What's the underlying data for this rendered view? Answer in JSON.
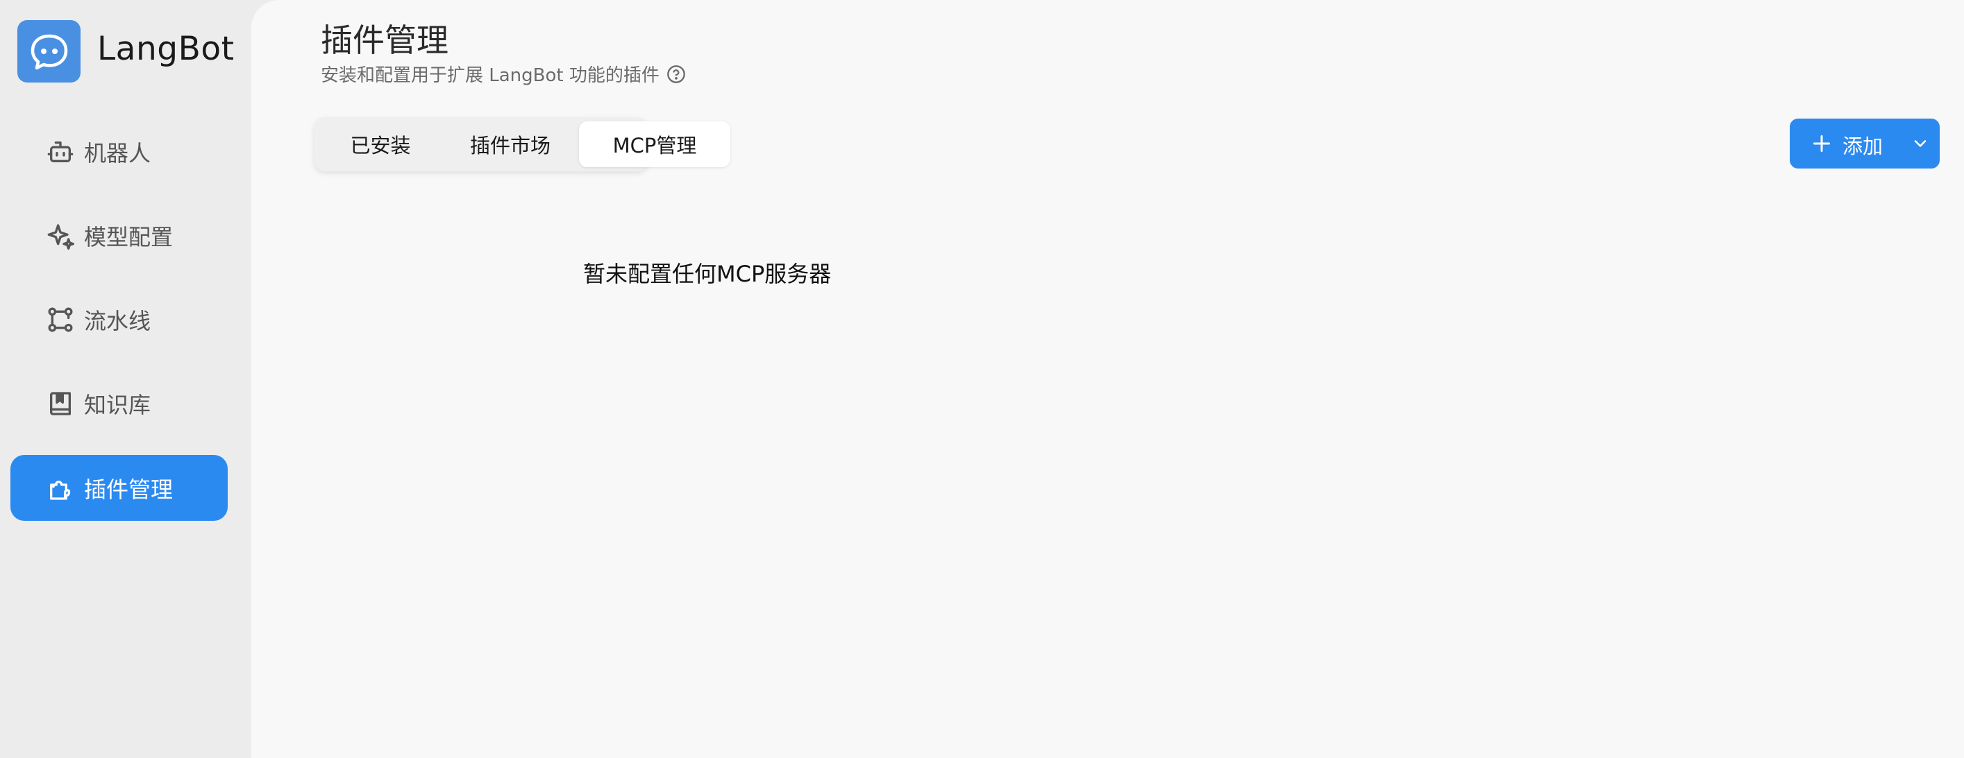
{
  "app": {
    "name": "LangBot",
    "brand_color": "#2b8af0",
    "logo_color": "#4a90e2"
  },
  "sidebar": {
    "items": [
      {
        "label": "机器人",
        "icon": "bot-icon",
        "active": false
      },
      {
        "label": "模型配置",
        "icon": "sparkles-icon",
        "active": false
      },
      {
        "label": "流水线",
        "icon": "workflow-icon",
        "active": false
      },
      {
        "label": "知识库",
        "icon": "book-icon",
        "active": false
      },
      {
        "label": "插件管理",
        "icon": "puzzle-icon",
        "active": true
      }
    ]
  },
  "page": {
    "title": "插件管理",
    "subtitle": "安装和配置用于扩展 LangBot 功能的插件"
  },
  "tabs": [
    {
      "label": "已安装",
      "active": false
    },
    {
      "label": "插件市场",
      "active": false
    },
    {
      "label": "MCP管理",
      "active": true
    }
  ],
  "toolbar": {
    "add_label": "添加"
  },
  "empty_state": {
    "message": "暂未配置任何MCP服务器"
  }
}
